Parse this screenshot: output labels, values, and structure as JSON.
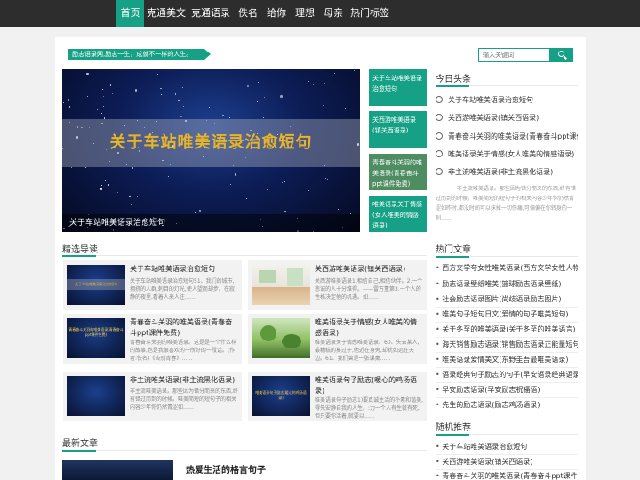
{
  "nav": {
    "items": [
      "首页",
      "克通美文",
      "克通语录",
      "佚名",
      "给你",
      "理想",
      "母亲",
      "热门标签"
    ]
  },
  "notice": {
    "text": "励志语录网,励志一生，成就不一样的人生。"
  },
  "search": {
    "placeholder": "输入关键词"
  },
  "slider": {
    "big_text": "关于车站唯美语录治愈短句",
    "caption": "关于车站唯美语录治愈短句"
  },
  "side_tiles": [
    "关于车站唯美语录治愈短句",
    "关西游唯美语录(镇关西语录)",
    "青春奋斗关羽的唯美语录(青春奋斗ppt课件免费)",
    "唯美语录关于情感(女人唯美的情感语录)"
  ],
  "featured": {
    "title": "精选导读",
    "items": [
      {
        "title": "关于车站唯美语录治愈短句",
        "desc": "关于车站唯美语录治愈短句51、我们的城市,拥挤的人群,刺目的灯光,使人望而却步。在寂静的夜里,看着人来人往……",
        "thumb_text": "关于车站唯美语录治愈短句"
      },
      {
        "title": "关西游唯美语录(镇关西语录)",
        "desc": "关西游唯美语录1,相信自己,相信伙伴。2.一个悲诚的人十分难得。——雷万董第3.一个人的性格决定他的机遇。如……",
        "thumb_text": ""
      },
      {
        "title": "青春奋斗关羽的唯美语录(青春奋斗ppt课件免费)",
        "desc": "青春奋斗关羽的唯美语录。这是是一个什么样的故事,也是我很喜欢的一所好的一段话。(作者:佚名)《告别青春》……",
        "thumb_text": "青春奋斗关羽的唯美语录(青春奋斗ppt课件免费)"
      },
      {
        "title": "唯美语录关于情感(女人唯美的情感语录)",
        "desc": "唯美语录关于情感唯美语录。60、失去某人,最糟糕的莫过于,他近在身旁,却犹如远在天边。61、我们曾是一张课桌……",
        "thumb_text": ""
      },
      {
        "title": "非主流唯美语录(非主流黑化语录)",
        "desc": "非主流唯美语录。那些因为错分而来的东西,终有错过而到的时候。唯美简短的短句子的相关内容少年你仍然青涩如……",
        "thumb_text": ""
      },
      {
        "title": "唯美语录句子励志(暖心的鸡汤语录)",
        "desc": "唯美语录句子励志1)要真诚生活的朴素和谐美,得先安静自我的人生。:力一个人有生就有死,但只要你活着,就要以……",
        "thumb_text": "唯美语录句子励志(暖心的鸡汤语录)"
      }
    ]
  },
  "headline": {
    "title": "今日头条",
    "items": [
      "关于车站唯美语录治愈短句",
      "关西游唯美语录(镇关西语录)",
      "青春奋斗关羽的唯美语录(青春奋斗ppt课件免费)",
      "唯美语录关于情感(女人唯美的情感语录)",
      "非主流唯美语录(非主流黑化语录)"
    ],
    "desc": "非主流唯美语录。那些因为错分而来的东西,终有错过而到的时候。唯美简短的短句子的相关内容少年你仍然青涩如昨时,都没时间可以抹掉一切伤痛,可偏偏在你转身的一刹……"
  },
  "hot": {
    "title": "热门文章",
    "items": [
      "西方文学夸女性唯美语录(西方文学女性人物)",
      "励志语录壁纸唯美(篮球励志语录壁纸)",
      "社会励志语录图片(尚歧语录励志图片)",
      "唯美句子短句日文(爱情的句子唯美短句)",
      "关于冬至的唯美语录(关于冬至的唯美语言)",
      "海天销售励志语录(销售励志语录正能量短句)",
      "唯美语录爱情美文(东野圭吾最唯美语录)",
      "语录经典句子励志的句子(早安语录经典语录)",
      "早安励志语录(早安励志祝福语)",
      "先生的励志语录(励志鸡汤语录)"
    ]
  },
  "random": {
    "title": "随机推荐",
    "items": [
      "关于车站唯美语录治愈短句",
      "关西游唯美语录(镇关西语录)",
      "青春奋斗关羽的唯美语录(青春奋斗ppt课件免费)"
    ]
  },
  "latest": {
    "title": "最新文章",
    "first_title": "热爱生活的格言句子"
  },
  "colors": {
    "accent": "#16a085",
    "nav_bg": "#2d2d2d"
  }
}
